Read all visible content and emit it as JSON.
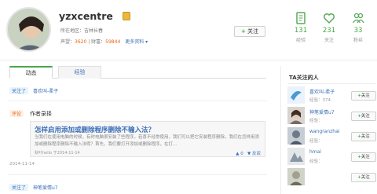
{
  "profile": {
    "username": "yzxcentre",
    "location": "所在地区：吉林长春",
    "reputation_label": "声望：",
    "reputation": "3620",
    "wealth_label": "财富：",
    "wealth": "59844",
    "more_info": "更多资料 ▾",
    "follow_label": "关注"
  },
  "stats": [
    {
      "count": "131",
      "label": "经验"
    },
    {
      "count": "231",
      "label": "关注"
    },
    {
      "count": "33",
      "label": "粉丝"
    }
  ],
  "tabs": {
    "active": "动态",
    "experience": "经验"
  },
  "feed": {
    "item1": {
      "tag": "关注了",
      "user": "喜欢叫-柔子"
    },
    "item2": {
      "tag": "评论",
      "action": "作者录择",
      "article_title": "怎样启用添加或删除程序删除不输入法？",
      "article_text": "当我们在使用电脑的时候，有时电脑很安装了些程序，若喜不经常使用，我们可以把它安装程序删除，我们在怎样用添加或删除程序删除不输入法呢？首先，我们要打开添加或删除程序，在打...",
      "article_meta": "秋叶hello 于2014-11-14",
      "vote_up": "▲ 0",
      "vote_down": "▼ 反驳",
      "timestamp": "2014-11-14"
    },
    "item3": {
      "tag": "关注了",
      "user": "神笔爱情u7"
    }
  },
  "sidebar": {
    "title": "TA关注的人",
    "fans": [
      {
        "name": "喜欢叫-柔子",
        "sub": "经验：374",
        "follow": "关注"
      },
      {
        "name": "神笔爱情u7",
        "sub": "经验：",
        "follow": "关注"
      },
      {
        "name": "wangranzhai",
        "sub": "经验：",
        "follow": "关注"
      },
      {
        "name": "hmai",
        "sub": "经验：",
        "follow": "关注"
      },
      {
        "name": "",
        "sub": "",
        "follow": "关注"
      }
    ]
  }
}
